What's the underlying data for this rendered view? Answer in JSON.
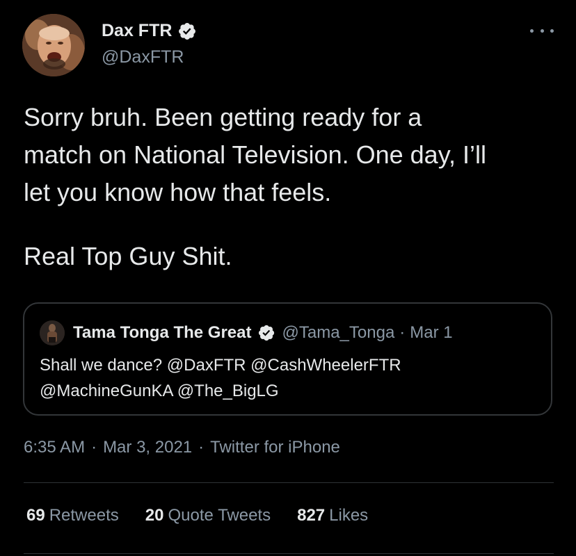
{
  "author": {
    "display_name": "Dax FTR",
    "handle": "@DaxFTR",
    "verified": true
  },
  "tweet": {
    "text_paragraph_1": [
      "Sorry bruh. Been getting ready for a",
      "match on National Television. One day, I’ll",
      "let you know how that feels."
    ],
    "text_paragraph_2": "Real Top Guy Shit."
  },
  "quoted_tweet": {
    "display_name": "Tama Tonga The Great",
    "handle": "@Tama_Tonga",
    "separator": "·",
    "date": "Mar 1",
    "verified": true,
    "text_lines": [
      "Shall we dance? @DaxFTR @CashWheelerFTR",
      "@MachineGunKA @The_BigLG"
    ]
  },
  "meta": {
    "time": "6:35 AM",
    "separator": "·",
    "date": "Mar 3, 2021",
    "source": "Twitter for iPhone"
  },
  "stats": {
    "retweets": {
      "count": "69",
      "label": "Retweets"
    },
    "quote_tweets": {
      "count": "20",
      "label": "Quote Tweets"
    },
    "likes": {
      "count": "827",
      "label": "Likes"
    }
  },
  "icons": {
    "verified_badge": "verified-badge-icon",
    "more_options": "more-options-icon"
  },
  "colors": {
    "background": "#000000",
    "primary_text": "#e7e9ea",
    "secondary_text": "#8b98a5",
    "border": "#333639",
    "verified_badge": "#e7e9ea"
  }
}
